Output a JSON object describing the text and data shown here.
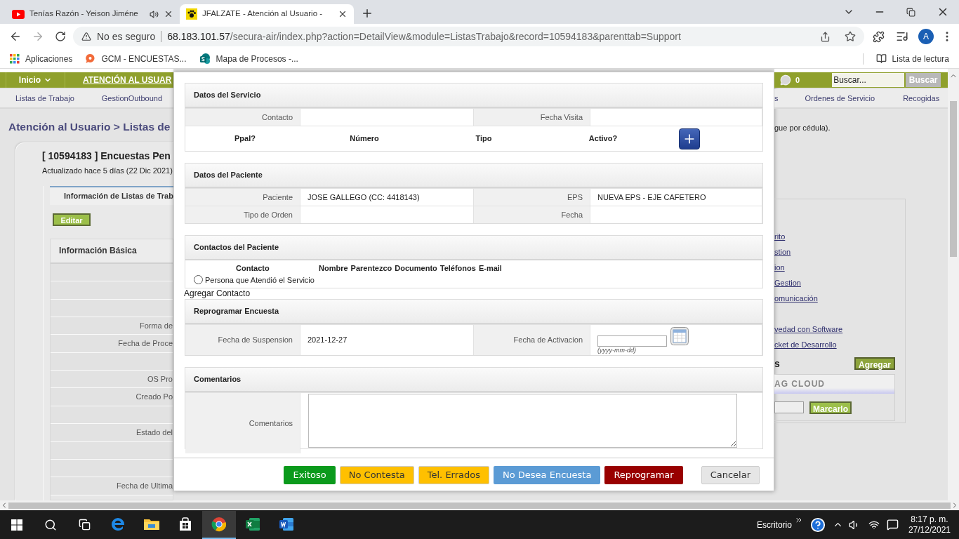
{
  "browser": {
    "tabs": [
      {
        "title": "Tenías Razón - Yeison Jiméne",
        "selected": false,
        "audio": true,
        "kind": "video"
      },
      {
        "title": "JFALZATE - Atención al Usuario -",
        "selected": true,
        "audio": false,
        "kind": "site"
      }
    ],
    "security": "No es seguro",
    "url_host": "68.183.101.57",
    "url_path": "/secura-air/index.php?action=DetailView&module=ListasTrabajo&record=10594183&parenttab=Support",
    "avatar": "A",
    "bookmarks": [
      {
        "label": "Aplicaciones",
        "kind": "apps"
      },
      {
        "label": "GCM - ENCUESTAS...",
        "kind": "gcm"
      },
      {
        "label": "Mapa de Procesos -...",
        "kind": "sharepoint"
      }
    ],
    "reading_list": "Lista de lectura"
  },
  "page": {
    "menu": "Inicio",
    "module": "ATENCIÓN AL USUAR",
    "nav_left": [
      "Listas de Trabajo",
      "GestionOutbound"
    ],
    "notifications": "0",
    "search_placeholder": "Buscar...",
    "search_button": "Buscar",
    "nav_right": [
      "s",
      "Ordenes de Servicio",
      "Recogidas"
    ],
    "breadcrumb": "Atención al Usuario > Listas de",
    "record_title": "[ 10594183 ] Encuestas Pen",
    "updated": "Actualizado hace 5 días (22 Dic 2021)",
    "hint": "gue por cédula).",
    "tab": "Información de Listas de Trab",
    "edit_button": "Editar",
    "basic_header": "Información Básica",
    "basic_rows": [
      {
        "kind": "blank"
      },
      {
        "kind": "blank"
      },
      {
        "kind": "blank"
      },
      {
        "kind": "field",
        "label": "Forma de"
      },
      {
        "kind": "field",
        "label": "Fecha de Proce"
      },
      {
        "kind": "blank"
      },
      {
        "kind": "field",
        "label": "OS Pro"
      },
      {
        "kind": "field",
        "label": "Creado Po"
      },
      {
        "kind": "blank"
      },
      {
        "kind": "field",
        "label": "Estado del"
      },
      {
        "kind": "blank"
      },
      {
        "kind": "blank"
      },
      {
        "kind": "field",
        "label": "Fecha de Ultima"
      }
    ],
    "links": [
      {
        "kind": "link",
        "label": "rito"
      },
      {
        "kind": "link",
        "label": "stion"
      },
      {
        "kind": "link",
        "label": "ion"
      },
      {
        "kind": "link",
        "label": "Gestion"
      },
      {
        "kind": "link",
        "label": "omunicación"
      },
      {
        "kind": "blank"
      },
      {
        "kind": "link",
        "label": "vedad con Software"
      },
      {
        "kind": "link",
        "label": "cket de Desarrollo"
      }
    ],
    "tags_heading": "s",
    "add_button": "Agregar",
    "tag_cloud": "AG CLOUD",
    "tag_button": "Marcarlo"
  },
  "modal": {
    "sections": [
      {
        "kind": "section",
        "title": "Datos del Servicio",
        "rows": [
          {
            "kind": "fields",
            "cells": [
              {
                "label": "Contacto"
              },
              {
                "label": "Fecha Visita"
              }
            ]
          },
          {
            "kind": "phone_header",
            "columns": [
              "Ppal?",
              "Número",
              "Tipo",
              "Activo?"
            ]
          }
        ]
      },
      {
        "kind": "section",
        "title": "Datos del Paciente",
        "rows": [
          {
            "kind": "fields",
            "cells": [
              {
                "label": "Paciente",
                "value": "JOSE GALLEGO (CC: 4418143)"
              },
              {
                "label": "EPS",
                "value": "NUEVA EPS - EJE CAFETERO"
              }
            ]
          },
          {
            "kind": "fields",
            "cells": [
              {
                "label": "Tipo de Orden"
              },
              {
                "label": "Fecha"
              }
            ]
          }
        ]
      },
      {
        "kind": "section",
        "title": "Contactos del Paciente",
        "rows": [
          {
            "kind": "contacts_header",
            "columns": [
              "Contacto",
              "Nombre",
              "Parentezco",
              "Documento",
              "Teléfonos",
              "E-mail"
            ]
          },
          {
            "kind": "radio",
            "label": "Persona que Atendió el Servicio",
            "selected": false
          }
        ]
      },
      {
        "kind": "text",
        "text": "Agregar Contacto"
      },
      {
        "kind": "section",
        "title": "Reprogramar Encuesta",
        "rows": [
          {
            "kind": "fields",
            "cells": [
              {
                "label": "Fecha de Suspension",
                "value": "2021-12-27"
              },
              {
                "label": "Fecha de Activacion",
                "kind": "date",
                "hint": "(yyyy-mm-dd)"
              }
            ]
          }
        ]
      },
      {
        "kind": "section",
        "title": "Comentarios",
        "rows": [
          {
            "kind": "textarea",
            "label": "Comentarios"
          }
        ]
      }
    ],
    "buttons": [
      {
        "label": "Exitoso",
        "color": "#0b9a1c"
      },
      {
        "label": "No Contesta",
        "color": "#ffc000"
      },
      {
        "label": "Tel. Errados",
        "color": "#ffc000"
      },
      {
        "label": "No Desea Encuesta",
        "color": "#5b9bd5"
      },
      {
        "label": "Reprogramar",
        "color": "#990000"
      },
      {
        "label": "Cancelar",
        "color": "#e6e6e6"
      }
    ]
  },
  "taskbar": {
    "apps": [
      {
        "kind": "edge",
        "active": false
      },
      {
        "kind": "explorer",
        "active": false
      },
      {
        "kind": "store",
        "active": false
      },
      {
        "kind": "chrome",
        "active": true
      },
      {
        "kind": "excel",
        "active": false
      },
      {
        "kind": "word",
        "active": false
      }
    ],
    "desktop": "Escritorio",
    "time": "8:17 p. m.",
    "date": "27/12/2021"
  }
}
